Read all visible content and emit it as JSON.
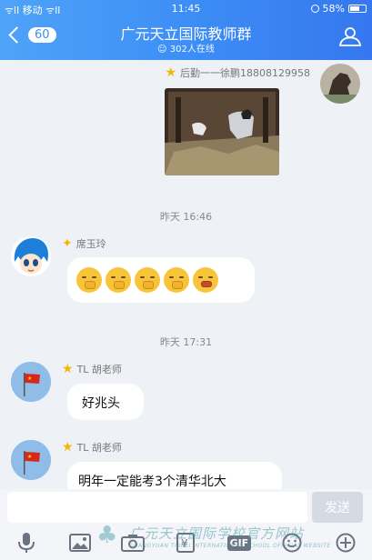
{
  "status_bar": {
    "carrier": "ᯤll 移动 ᯤll",
    "time": "11:45",
    "battery": "58%"
  },
  "header": {
    "back_count": "60",
    "title": "广元天立国际教师群",
    "online": "302人在线"
  },
  "messages": [
    {
      "sender": "后勤一一徐鹏18808129958",
      "type": "image"
    },
    {
      "timestamp": "昨天 16:46"
    },
    {
      "sender": "席玉玲",
      "type": "emoji"
    },
    {
      "timestamp": "昨天 17:31"
    },
    {
      "sender": "TL 胡老师",
      "text": "好兆头"
    },
    {
      "sender": "TL 胡老师",
      "text": "明年一定能考3个清华北大"
    }
  ],
  "input": {
    "send_label": "发送"
  },
  "toolbar": {
    "gif_label": "GIF"
  },
  "watermark": {
    "text": "广元天立国际学校官方网站",
    "sub": "GUANGYUAN TIANLI INTERNATIONAL SCHOOL OFFICIAL WEBSITE"
  },
  "colors": {
    "header": "#3d8ef6",
    "background": "#eef1f6",
    "bubble": "#ffffff",
    "send_disabled": "#d6dbe3"
  }
}
